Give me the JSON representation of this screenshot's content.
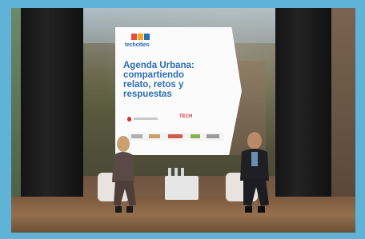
{
  "screen": {
    "logo": {
      "name": "techcities",
      "subtitle": "Agenda Urbana",
      "colors": [
        "#e74c3c",
        "#f5a623",
        "#2c6fb5"
      ]
    },
    "headline_lines": [
      "Agenda Urbana:",
      "compartiendo",
      "relato, retos y",
      "respuestas"
    ],
    "sponsor": "TECH",
    "brand_color": "#2c6fb5",
    "accent_color": "#d23a3a"
  }
}
